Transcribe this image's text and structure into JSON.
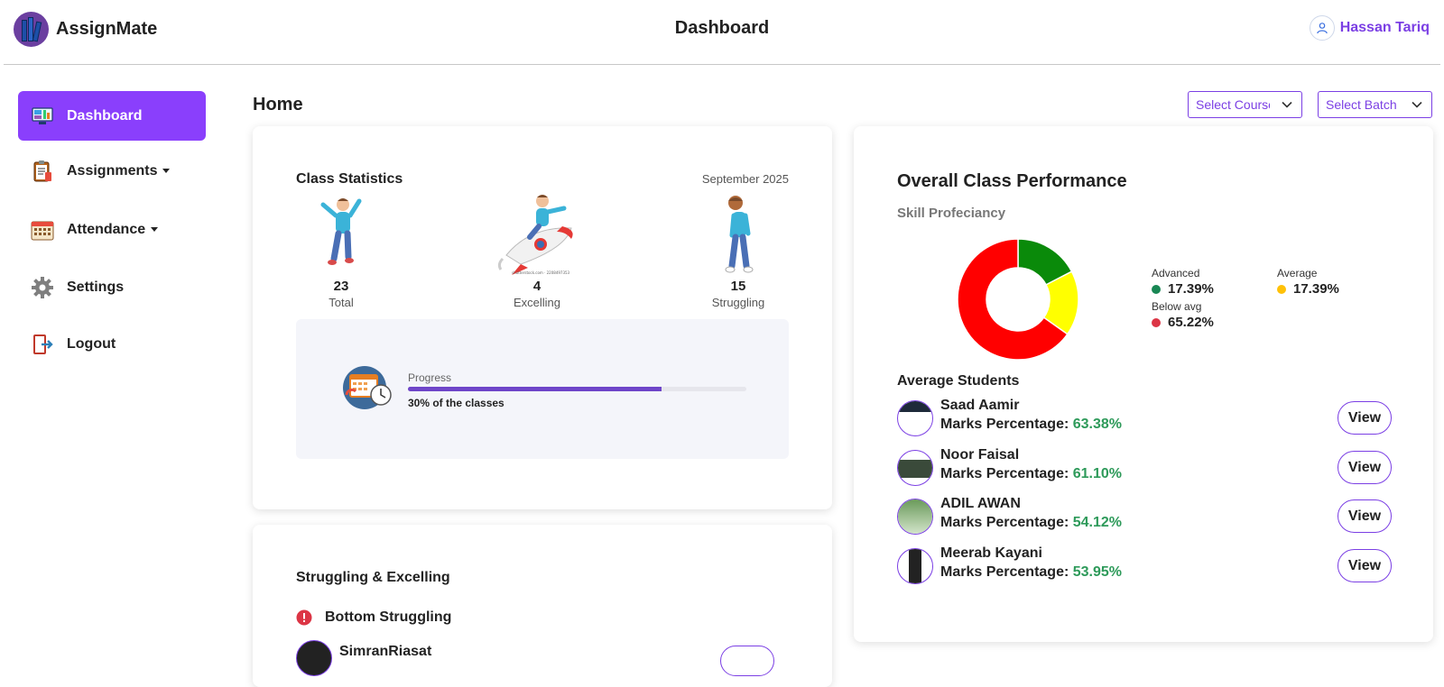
{
  "header": {
    "brand": "AssignMate",
    "title": "Dashboard",
    "user_name": "Hassan Tariq"
  },
  "sidebar": {
    "items": [
      {
        "label": "Dashboard",
        "icon": "monitor-icon",
        "active": true
      },
      {
        "label": "Assignments",
        "icon": "clipboard-icon",
        "dropdown": true
      },
      {
        "label": "Attendance",
        "icon": "calendar-icon",
        "dropdown": true
      },
      {
        "label": "Settings",
        "icon": "gear-icon"
      },
      {
        "label": "Logout",
        "icon": "logout-icon"
      }
    ]
  },
  "main": {
    "title": "Home",
    "select_course": "Select Course",
    "select_batch": "Select Batch"
  },
  "class_statistics": {
    "title": "Class Statistics",
    "date": "September 2025",
    "stats": [
      {
        "value": "23",
        "label": "Total"
      },
      {
        "value": "4",
        "label": "Excelling"
      },
      {
        "value": "15",
        "label": "Struggling"
      }
    ],
    "progress": {
      "label": "Progress",
      "text": "30% of the classes",
      "fill_fraction": 0.75
    }
  },
  "struggling_excelling": {
    "title": "Struggling & Excelling",
    "subtitle": "Bottom Struggling",
    "first_student": "SimranRiasat"
  },
  "performance": {
    "title": "Overall Class Performance",
    "subtitle": "Skill Profeciancy",
    "chart_data": {
      "type": "pie",
      "categories": [
        "Advanced",
        "Average",
        "Below avg"
      ],
      "values": [
        17.39,
        17.39,
        65.22
      ],
      "labels": [
        "17.39%",
        "17.39%",
        "65.22%"
      ],
      "colors": [
        "#0a8a0a",
        "#ffff00",
        "#ff0000"
      ],
      "legend_colors": [
        "#198754",
        "#ffc107",
        "#dc3545"
      ],
      "legend_position": "right"
    },
    "avg_title": "Average Students",
    "marks_label": "Marks Percentage:",
    "view_label": "View",
    "students": [
      {
        "name": "Saad Aamir",
        "pct": "63.38%"
      },
      {
        "name": "Noor Faisal",
        "pct": "61.10%"
      },
      {
        "name": "ADIL AWAN",
        "pct": "54.12%"
      },
      {
        "name": "Meerab Kayani",
        "pct": "53.95%"
      }
    ]
  }
}
